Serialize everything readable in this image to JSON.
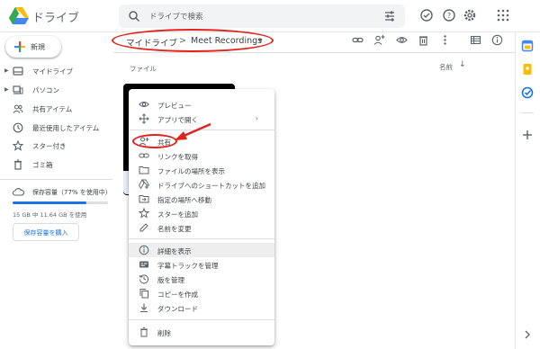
{
  "app": {
    "title": "ドライブ"
  },
  "search": {
    "placeholder": "ドライブで検索"
  },
  "header_icons": [
    "offline-check-icon",
    "help-icon",
    "settings-icon",
    "apps-grid-icon"
  ],
  "sidebar": {
    "new_label": "新規",
    "items": [
      {
        "label": "マイドライブ",
        "icon": "drive-icon",
        "expandable": true
      },
      {
        "label": "パソコン",
        "icon": "computer-icon",
        "expandable": true
      },
      {
        "label": "共有アイテム",
        "icon": "shared-icon",
        "expandable": false
      },
      {
        "label": "最近使用したアイテム",
        "icon": "recent-icon",
        "expandable": false
      },
      {
        "label": "スター付き",
        "icon": "star-icon",
        "expandable": false
      },
      {
        "label": "ゴミ箱",
        "icon": "trash-icon",
        "expandable": false
      }
    ],
    "storage": {
      "label": "保存容量（77% を使用中）",
      "percent_used": 77,
      "detail": "15 GB 中 11.64 GB を使用",
      "buy_label": "保存容量を購入"
    }
  },
  "breadcrumb": {
    "root": "マイドライブ",
    "separator": ">",
    "current": "Meet Recordings"
  },
  "toolbar_icons": [
    "link-icon",
    "add-person-icon",
    "preview-icon",
    "delete-icon",
    "more-icon",
    "list-view-icon",
    "info-icon"
  ],
  "list": {
    "section_label": "ファイル",
    "sort_label": "名前",
    "sort_arrow": "↓"
  },
  "context_menu": {
    "groups": [
      [
        {
          "label": "プレビュー",
          "icon": "eye-icon"
        },
        {
          "label": "アプリで開く",
          "icon": "open-with-icon",
          "submenu": true
        }
      ],
      [
        {
          "label": "共有",
          "icon": "share-person-icon",
          "highlighted": true
        },
        {
          "label": "リンクを取得",
          "icon": "link-icon"
        },
        {
          "label": "ファイルの場所を表示",
          "icon": "folder-icon"
        },
        {
          "label": "ドライブへのショートカットを追加",
          "icon": "shortcut-icon"
        },
        {
          "label": "指定の場所へ移動",
          "icon": "move-icon"
        },
        {
          "label": "スターを追加",
          "icon": "star-icon"
        },
        {
          "label": "名前を変更",
          "icon": "rename-icon"
        }
      ],
      [
        {
          "label": "詳細を表示",
          "icon": "info-icon",
          "hover": true
        },
        {
          "label": "字幕トラックを管理",
          "icon": "captions-icon"
        },
        {
          "label": "版を管理",
          "icon": "versions-icon"
        },
        {
          "label": "コピーを作成",
          "icon": "copy-icon"
        },
        {
          "label": "ダウンロード",
          "icon": "download-icon"
        }
      ],
      [
        {
          "label": "削除",
          "icon": "delete-icon"
        }
      ]
    ],
    "submenu_chevron": "›"
  },
  "side_panel_icons": [
    "calendar-icon",
    "keep-icon",
    "tasks-icon",
    "add-icon"
  ],
  "colors": {
    "accent": "#1a73e8",
    "annotation": "#e0231c",
    "yellow": "#fbbc04",
    "green": "#34a853",
    "red": "#ea4335"
  }
}
